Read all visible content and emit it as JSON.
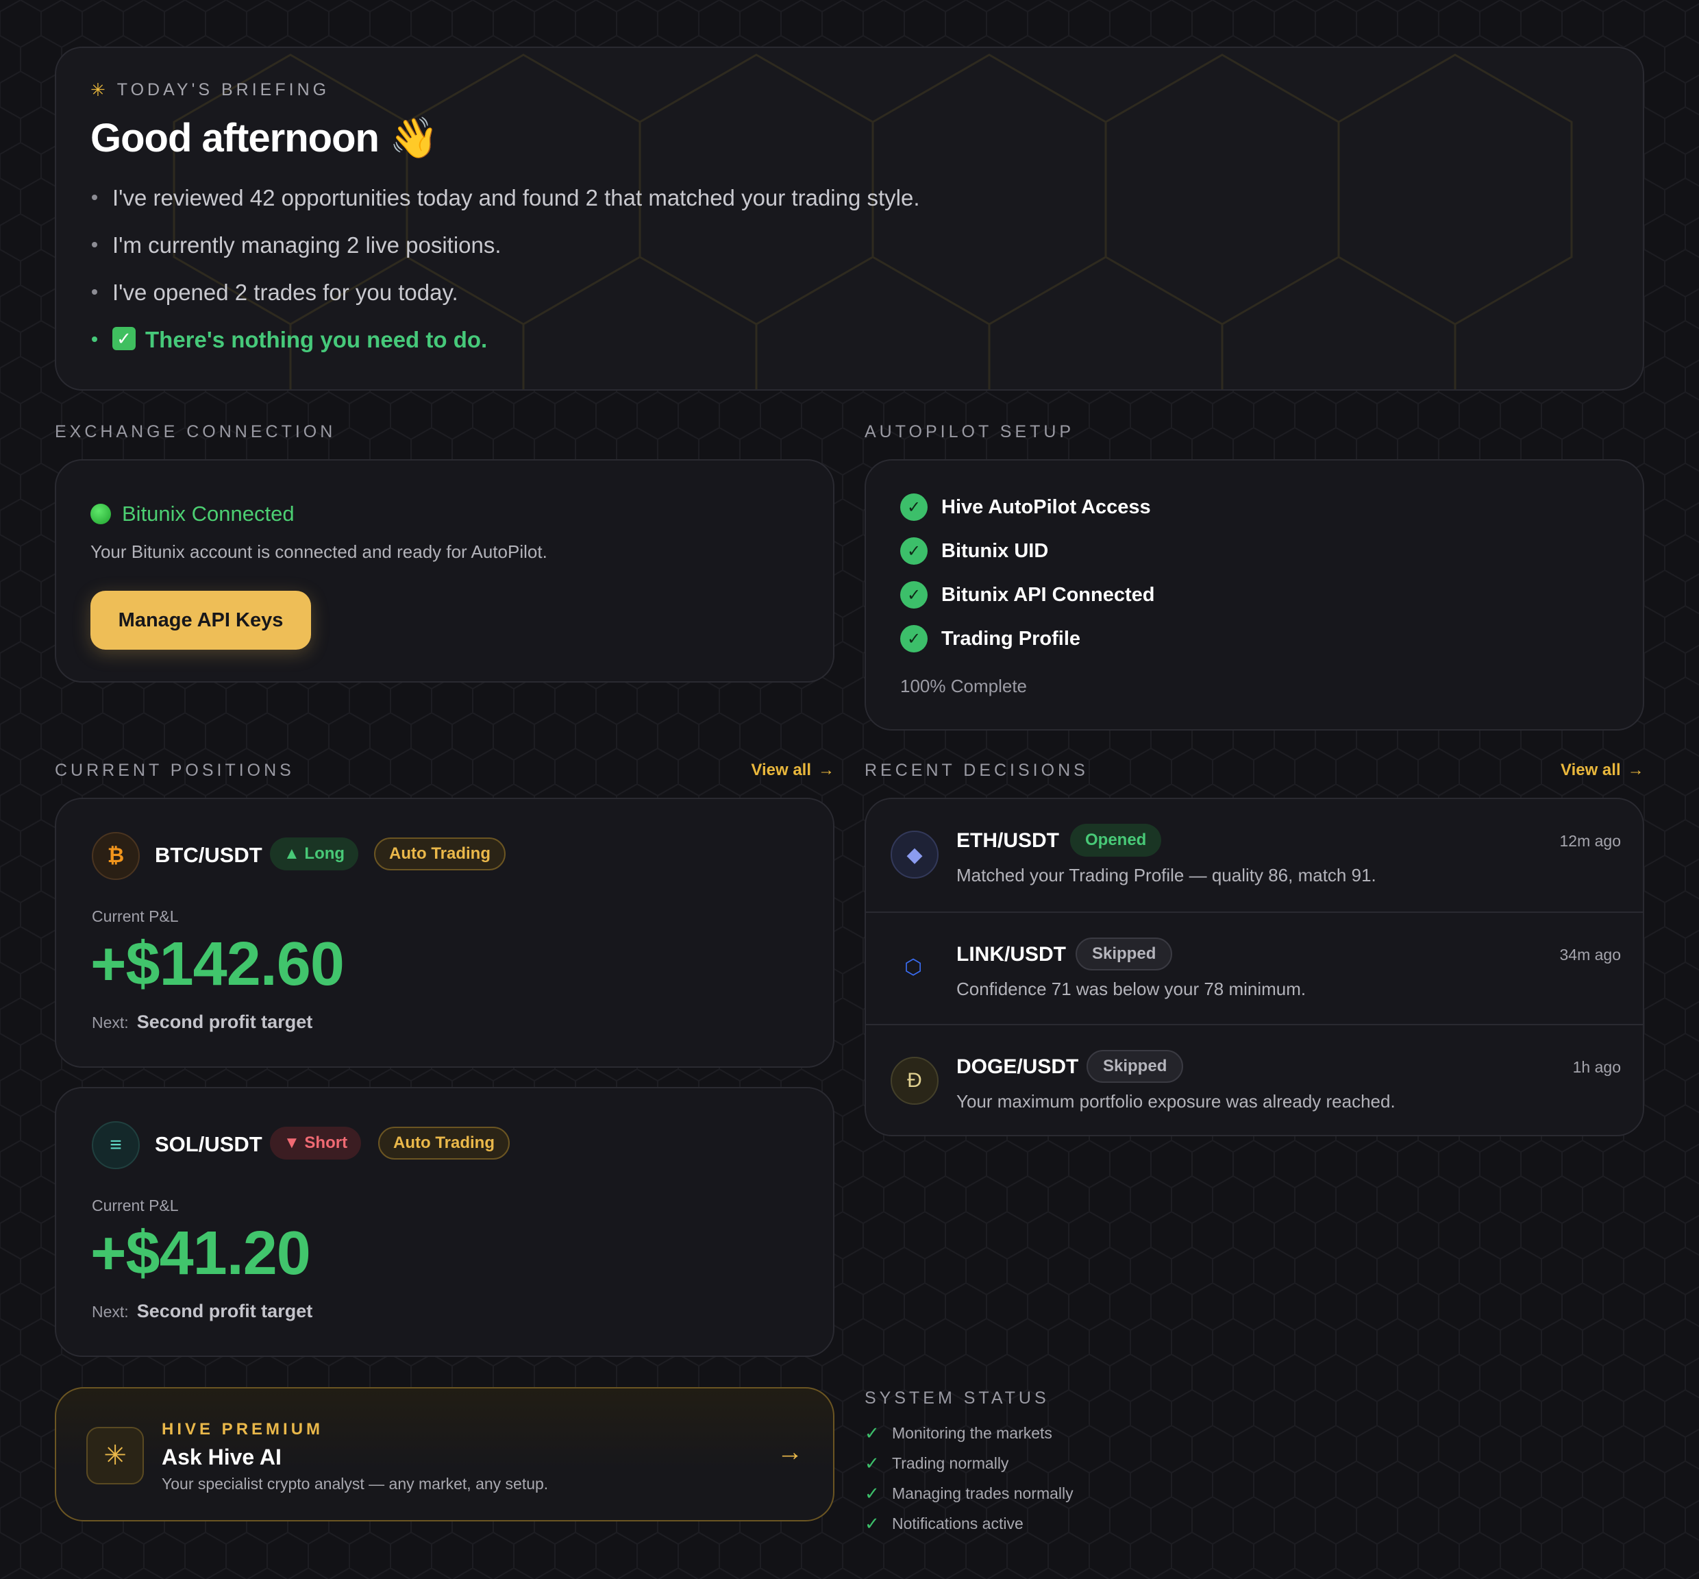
{
  "colors": {
    "bg": "#121216",
    "card": "#17171c",
    "accent_gold": "#eab84a",
    "green": "#41c56c",
    "red": "#f06a73"
  },
  "briefing": {
    "kicker": "TODAY'S BRIEFING",
    "kicker_icon": "sparkle-icon",
    "greeting": "Good afternoon 👋",
    "bullets": [
      "I've reviewed 42 opportunities today and found 2 that matched your trading style.",
      "I'm currently managing 2 live positions.",
      "I've opened 2 trades for you today."
    ],
    "ok_icon": "✅",
    "ok_text": "There's nothing you need to do."
  },
  "exchange": {
    "section_label": "EXCHANGE CONNECTION",
    "status_title": "Bitunix Connected",
    "description": "Your Bitunix account is connected and ready for AutoPilot.",
    "button_label": "Manage API Keys"
  },
  "autopilot": {
    "section_label": "AUTOPILOT SETUP",
    "items": [
      "Hive AutoPilot Access",
      "Bitunix UID",
      "Bitunix API Connected",
      "Trading Profile"
    ],
    "progress_text": "100% Complete"
  },
  "positions": {
    "section_label": "CURRENT POSITIONS",
    "view_all": "View all",
    "pnl_label": "Current P&L",
    "next_label": "Next:",
    "items": [
      {
        "coin_icon": "₿",
        "pair": "BTC/USDT",
        "direction": "▲ Long",
        "mode": "Auto Trading",
        "pnl": "+$142.60",
        "next": "Second profit target"
      },
      {
        "coin_icon": "≡",
        "pair": "SOL/USDT",
        "direction": "▼ Short",
        "mode": "Auto Trading",
        "pnl": "+$41.20",
        "next": "Second profit target"
      }
    ]
  },
  "decisions": {
    "section_label": "RECENT DECISIONS",
    "view_all": "View all",
    "items": [
      {
        "icon": "◆",
        "pair": "ETH/USDT",
        "status": "Opened",
        "time": "12m ago",
        "text": "Matched your Trading Profile — quality 86, match 91."
      },
      {
        "icon": "⬡",
        "pair": "LINK/USDT",
        "status": "Skipped",
        "time": "34m ago",
        "text": "Confidence 71 was below your 78 minimum."
      },
      {
        "icon": "Ð",
        "pair": "DOGE/USDT",
        "status": "Skipped",
        "time": "1h ago",
        "text": "Your maximum portfolio exposure was already reached."
      }
    ]
  },
  "premium": {
    "kicker": "HIVE PREMIUM",
    "title": "Ask Hive AI",
    "subtitle": "Your specialist crypto analyst — any market, any setup."
  },
  "system": {
    "section_label": "SYSTEM STATUS",
    "items": [
      "Monitoring the markets",
      "Trading normally",
      "Managing trades normally",
      "Notifications active"
    ]
  }
}
